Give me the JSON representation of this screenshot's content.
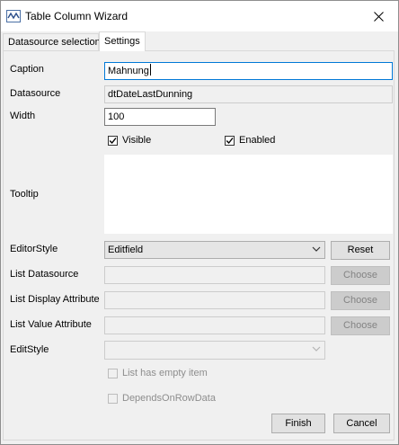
{
  "window": {
    "title": "Table Column Wizard",
    "icon": "wave-icon",
    "close_glyph": "✕"
  },
  "tabs": [
    {
      "label": "Datasource selection",
      "active": false
    },
    {
      "label": "Settings",
      "active": true
    }
  ],
  "form": {
    "caption": {
      "label": "Caption",
      "value": "Mahnung"
    },
    "datasource": {
      "label": "Datasource",
      "value": "dtDateLastDunning"
    },
    "width": {
      "label": "Width",
      "value": "100"
    },
    "visible": {
      "label": "Visible",
      "checked": true
    },
    "enabled": {
      "label": "Enabled",
      "checked": true
    },
    "tooltip": {
      "label": "Tooltip",
      "value": ""
    },
    "editor_style": {
      "label": "EditorStyle",
      "value": "Editfield",
      "reset_label": "Reset"
    },
    "list_datasource": {
      "label": "List Datasource",
      "value": "",
      "choose_label": "Choose"
    },
    "list_display_attribute": {
      "label": "List Display Attribute",
      "value": "",
      "choose_label": "Choose"
    },
    "list_value_attribute": {
      "label": "List Value Attribute",
      "value": "",
      "choose_label": "Choose"
    },
    "edit_style": {
      "label": "EditStyle",
      "value": ""
    },
    "list_has_empty_item": {
      "label": "List has empty item",
      "checked": false
    },
    "depends_on_row_data": {
      "label": "DependsOnRowData",
      "checked": false
    }
  },
  "footer": {
    "finish_label": "Finish",
    "cancel_label": "Cancel"
  },
  "colors": {
    "focus_border": "#0078d7",
    "window_bg": "#f0f0f0"
  }
}
